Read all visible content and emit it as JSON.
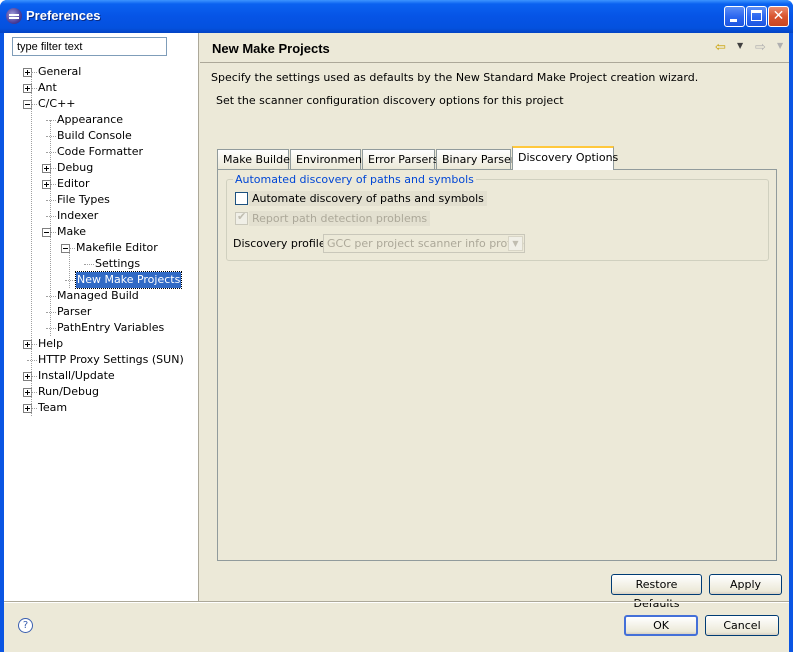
{
  "window": {
    "title": "Preferences"
  },
  "titlebar": {
    "min_glyph": "",
    "max_glyph": "",
    "close_glyph": "✕"
  },
  "filter": {
    "value": "type filter text"
  },
  "tree": [
    {
      "label": "General"
    },
    {
      "label": "Ant"
    },
    {
      "label": "C/C++"
    },
    {
      "label": "Appearance"
    },
    {
      "label": "Build Console"
    },
    {
      "label": "Code Formatter"
    },
    {
      "label": "Debug"
    },
    {
      "label": "Editor"
    },
    {
      "label": "File Types"
    },
    {
      "label": "Indexer"
    },
    {
      "label": "Make"
    },
    {
      "label": "Makefile Editor"
    },
    {
      "label": "Settings"
    },
    {
      "label": "New Make Projects"
    },
    {
      "label": "Managed Build"
    },
    {
      "label": "Parser"
    },
    {
      "label": "PathEntry Variables"
    },
    {
      "label": "Help"
    },
    {
      "label": "HTTP Proxy Settings (SUN)"
    },
    {
      "label": "Install/Update"
    },
    {
      "label": "Run/Debug"
    },
    {
      "label": "Team"
    }
  ],
  "page": {
    "title": "New Make Projects",
    "description": "Specify the settings used as defaults by the New Standard Make Project creation wizard.",
    "subdescription": "Set the scanner configuration discovery options for this project"
  },
  "nav": {
    "back_icon": "back-arrow-icon",
    "forward_icon": "forward-arrow-icon",
    "back": "⇦",
    "forward": "⇨",
    "drop": "▼"
  },
  "tabs": [
    {
      "label": "Make Builder"
    },
    {
      "label": "Environment"
    },
    {
      "label": "Error Parsers"
    },
    {
      "label": "Binary Parser"
    },
    {
      "label": "Discovery Options"
    }
  ],
  "discovery": {
    "group_title": "Automated discovery of paths and symbols",
    "automate_label": "Automate discovery of paths and symbols",
    "automate_checked": false,
    "report_label": "Report path detection problems",
    "report_checked": true,
    "profile_label": "Discovery profile:",
    "profile_value": "GCC per project scanner info profile"
  },
  "buttons": {
    "restore_defaults": "Restore Defaults",
    "apply": "Apply",
    "ok": "OK",
    "cancel": "Cancel",
    "help": "?"
  },
  "colors": {
    "titlebar": "#0a55e3",
    "selection": "#316ac5",
    "group_title": "#0046d5",
    "active_tab_accent": "#ffc83c"
  }
}
